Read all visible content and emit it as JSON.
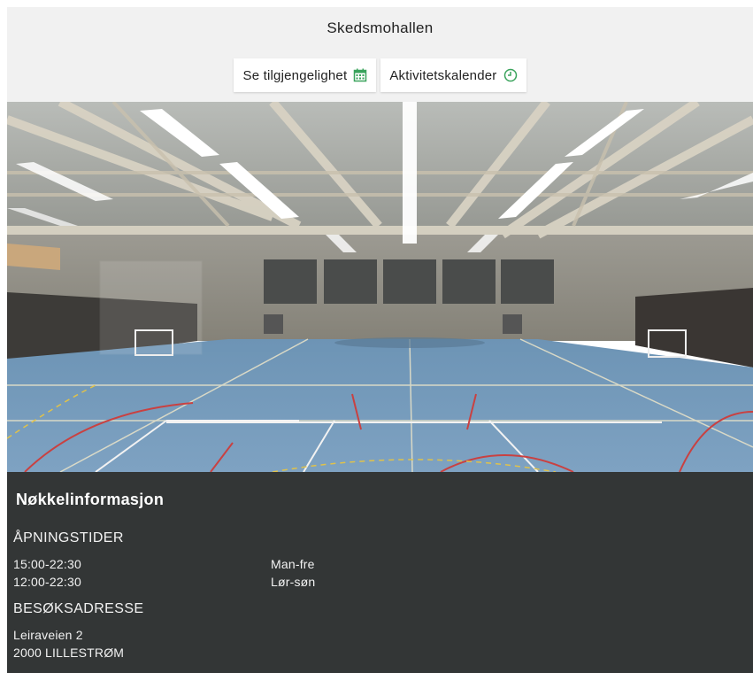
{
  "header": {
    "title": "Skedsmohallen",
    "availability_label": "Se tilgjengelighet",
    "availability_icon": "calendar-icon",
    "calendar_label": "Aktivitetskalender",
    "calendar_icon": "clock-icon",
    "accent_color": "#3aa35c"
  },
  "info": {
    "heading": "Nøkkelinformasjon",
    "opening_hours_title": "ÅPNINGSTIDER",
    "opening_hours": [
      {
        "time": "15:00-22:30",
        "days": "Man-fre"
      },
      {
        "time": "12:00-22:30",
        "days": "Lør-søn"
      }
    ],
    "address_title": "BESØKSADRESSE",
    "address_line1": "Leiraveien 2",
    "address_line2": "2000 LILLESTRØM",
    "background_color": "#333636"
  }
}
